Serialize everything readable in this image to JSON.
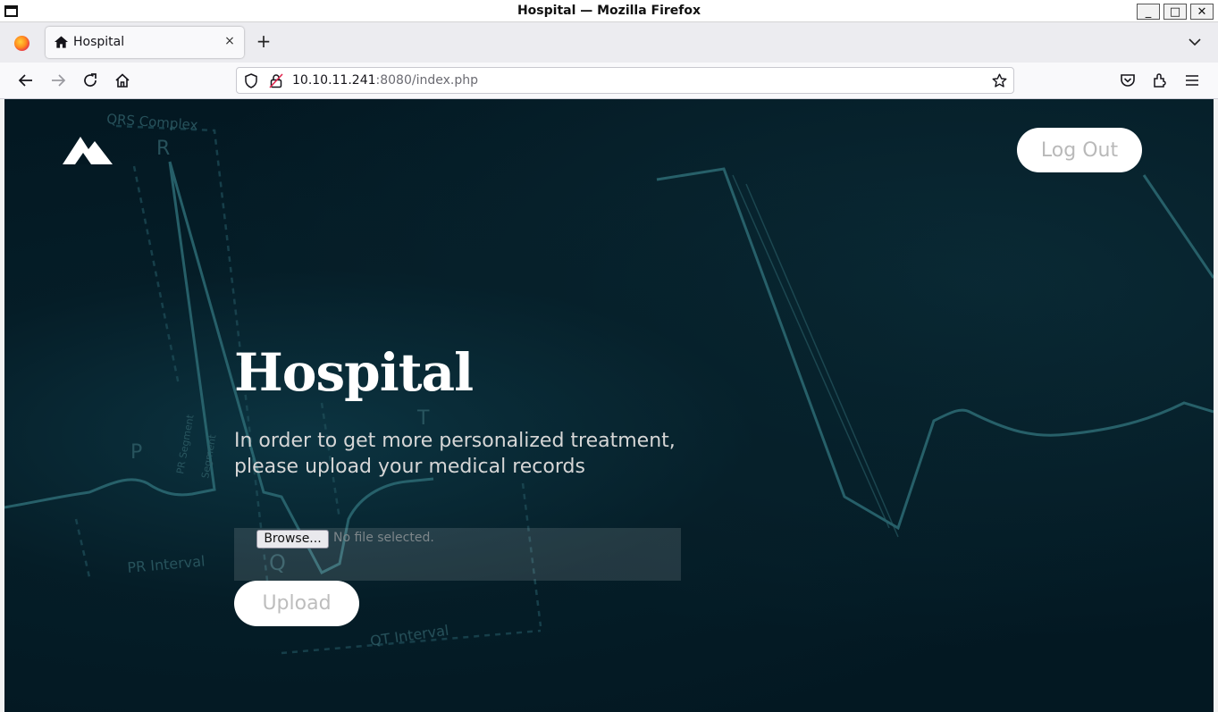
{
  "window": {
    "title": "Hospital — Mozilla Firefox",
    "minimize": "_",
    "maximize": "□",
    "close": "✕"
  },
  "browser": {
    "tab": {
      "label": "Hospital",
      "close": "×"
    },
    "new_tab": "+",
    "url": {
      "host": "10.10.11.241",
      "rest": ":8080/index.php"
    }
  },
  "page": {
    "logout_label": "Log Out",
    "hero_title": "Hospital",
    "hero_line1": "In order to get more personalized treatment,",
    "hero_line2": "please upload your medical records",
    "browse_label": "Browse...",
    "file_status": "No file selected.",
    "upload_label": "Upload",
    "background_labels": {
      "qrs": "QRS Complex",
      "r": "R",
      "p": "P",
      "t": "T",
      "q": "Q",
      "pr_interval": "PR Interval",
      "qt_interval": "QT Interval",
      "pr_segment": "PR Segment",
      "st_segment": "Segment"
    }
  },
  "colors": {
    "page_bg": "#031822",
    "ecg_line": "#2f6f78",
    "button_bg": "#ffffff"
  }
}
